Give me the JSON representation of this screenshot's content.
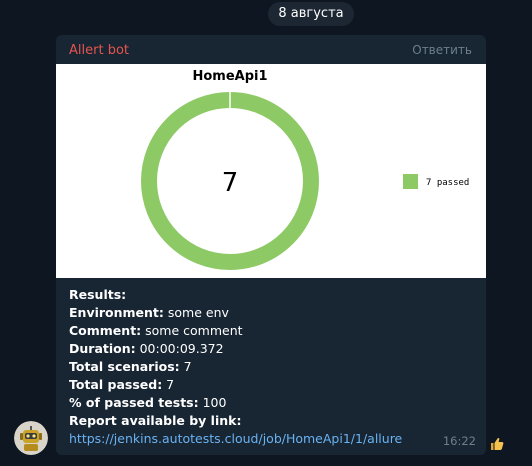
{
  "date_divider": "8 августа",
  "message": {
    "sender": "Allert bot",
    "reply_label": "Ответить",
    "time": "16:22",
    "lines": {
      "results": {
        "label": "Results:"
      },
      "environment": {
        "label": "Environment:",
        "value": " some env"
      },
      "comment": {
        "label": "Comment:",
        "value": " some comment"
      },
      "duration": {
        "label": "Duration:",
        "value": " 00:00:09.372"
      },
      "total_scenarios": {
        "label": "Total scenarios:",
        "value": " 7"
      },
      "total_passed": {
        "label": "Total passed:",
        "value": " 7"
      },
      "percent_passed": {
        "label": "% of passed tests:",
        "value": " 100"
      },
      "report": {
        "label": "Report available by link:"
      },
      "link": "https://jenkins.autotests.cloud/job/HomeApi1/1/allure"
    }
  },
  "reaction_icon": "thumbs-up-icon",
  "avatar_icon": "robot-avatar-icon",
  "chart_data": {
    "type": "pie",
    "donut": true,
    "title": "HomeApi1",
    "center_label": "7",
    "categories": [
      "passed"
    ],
    "values": [
      7
    ],
    "legend": [
      "7 passed"
    ],
    "legend_position": "right",
    "colors": [
      "#8dc965"
    ]
  }
}
